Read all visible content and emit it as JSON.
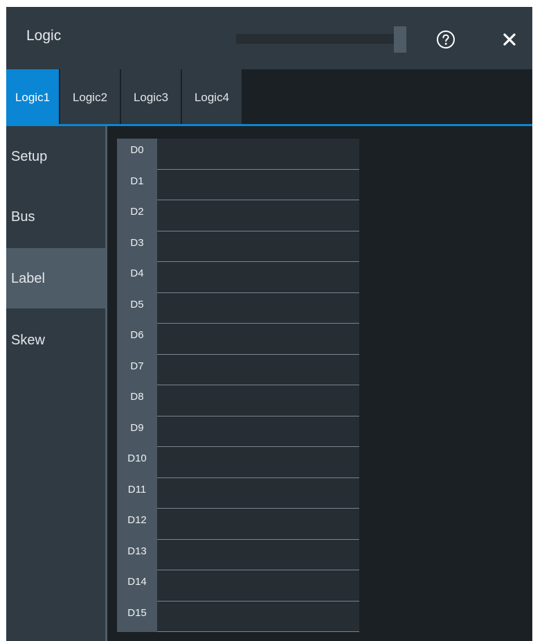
{
  "dialog": {
    "title": "Logic",
    "help_icon": "help-circle-icon",
    "close_icon": "close-icon"
  },
  "tabs": [
    {
      "label": "Logic1",
      "active": true
    },
    {
      "label": "Logic2",
      "active": false
    },
    {
      "label": "Logic3",
      "active": false
    },
    {
      "label": "Logic4",
      "active": false
    }
  ],
  "sidenav": [
    {
      "label": "Setup",
      "active": false
    },
    {
      "label": "Bus",
      "active": false
    },
    {
      "label": "Label",
      "active": true
    },
    {
      "label": "Skew",
      "active": false
    }
  ],
  "labels": [
    {
      "channel": "D0",
      "value": ""
    },
    {
      "channel": "D1",
      "value": ""
    },
    {
      "channel": "D2",
      "value": ""
    },
    {
      "channel": "D3",
      "value": ""
    },
    {
      "channel": "D4",
      "value": ""
    },
    {
      "channel": "D5",
      "value": ""
    },
    {
      "channel": "D6",
      "value": ""
    },
    {
      "channel": "D7",
      "value": ""
    },
    {
      "channel": "D8",
      "value": ""
    },
    {
      "channel": "D9",
      "value": ""
    },
    {
      "channel": "D10",
      "value": ""
    },
    {
      "channel": "D11",
      "value": ""
    },
    {
      "channel": "D12",
      "value": ""
    },
    {
      "channel": "D13",
      "value": ""
    },
    {
      "channel": "D14",
      "value": ""
    },
    {
      "channel": "D15",
      "value": ""
    }
  ],
  "colors": {
    "accent": "#0a86d4",
    "panel": "#303a43",
    "background": "#1b2025",
    "selected": "#4e5c68"
  }
}
